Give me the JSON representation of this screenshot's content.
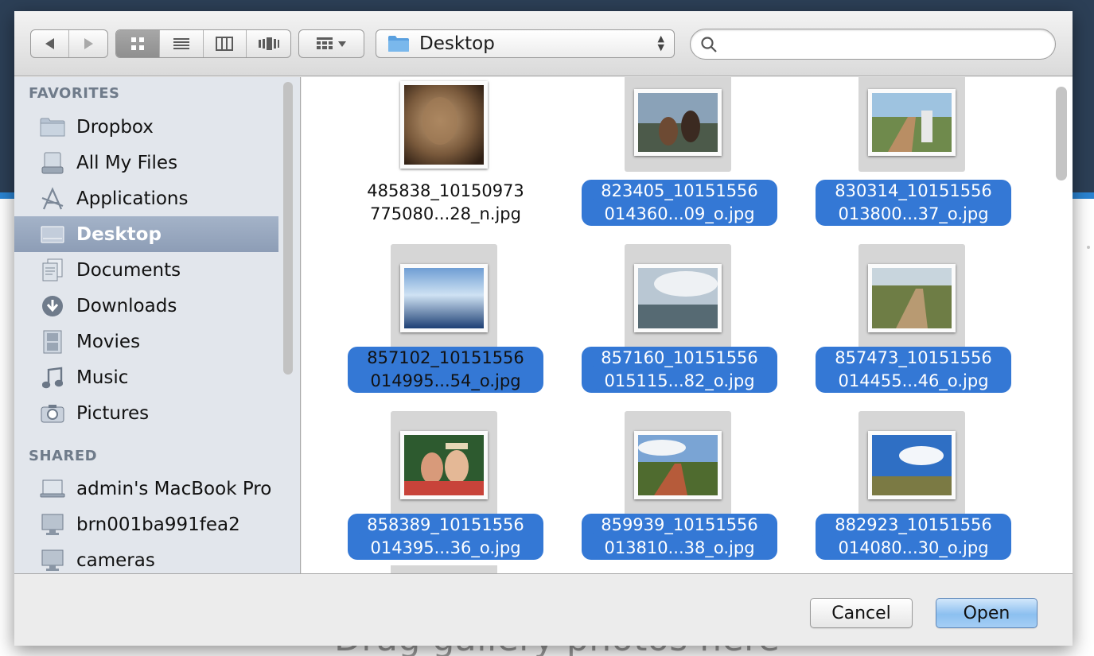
{
  "background_page": {
    "drag_hint": "Drag gallery photos here"
  },
  "toolbar": {
    "back_icon": "back-arrow-icon",
    "forward_icon": "forward-arrow-icon",
    "view_modes": [
      "icon-view",
      "list-view",
      "column-view",
      "cover-flow-view"
    ],
    "active_view": "icon-view",
    "arrange_icon": "arrange-grid-icon",
    "location_label": "Desktop",
    "search": {
      "value": "",
      "placeholder": ""
    }
  },
  "sidebar": {
    "favorites_header": "FAVORITES",
    "favorites": [
      {
        "label": "Dropbox",
        "icon": "folder-icon"
      },
      {
        "label": "All My Files",
        "icon": "all-files-icon"
      },
      {
        "label": "Applications",
        "icon": "applications-icon"
      },
      {
        "label": "Desktop",
        "icon": "desktop-icon"
      },
      {
        "label": "Documents",
        "icon": "documents-icon"
      },
      {
        "label": "Downloads",
        "icon": "downloads-icon"
      },
      {
        "label": "Movies",
        "icon": "movies-icon"
      },
      {
        "label": "Music",
        "icon": "music-icon"
      },
      {
        "label": "Pictures",
        "icon": "camera-icon"
      }
    ],
    "selected": "Desktop",
    "shared_header": "SHARED",
    "shared": [
      {
        "label": "admin's MacBook Pro",
        "icon": "laptop-icon"
      },
      {
        "label": "brn001ba991fea2",
        "icon": "monitor-icon"
      },
      {
        "label": "cameras",
        "icon": "monitor-icon"
      }
    ]
  },
  "files": [
    {
      "line1": "485838_10150973",
      "line2": "775080...28_n.jpg",
      "selected": false
    },
    {
      "line1": "823405_10151556",
      "line2": "014360...09_o.jpg",
      "selected": true
    },
    {
      "line1": "830314_10151556",
      "line2": "013800...37_o.jpg",
      "selected": true
    },
    {
      "line1": "857102_10151556",
      "line2": "014995...54_o.jpg",
      "selected": true
    },
    {
      "line1": "857160_10151556",
      "line2": "015115...82_o.jpg",
      "selected": true
    },
    {
      "line1": "857473_10151556",
      "line2": "014455...46_o.jpg",
      "selected": true
    },
    {
      "line1": "858389_10151556",
      "line2": "014395...36_o.jpg",
      "selected": true
    },
    {
      "line1": "859939_10151556",
      "line2": "013810...38_o.jpg",
      "selected": true
    },
    {
      "line1": "882923_10151556",
      "line2": "014080...30_o.jpg",
      "selected": true
    }
  ],
  "buttons": {
    "cancel": "Cancel",
    "open": "Open"
  },
  "colors": {
    "selection": "#3478d5",
    "sidebar_selected": "#98a8bf",
    "primary_button": "#8cc0f0"
  }
}
